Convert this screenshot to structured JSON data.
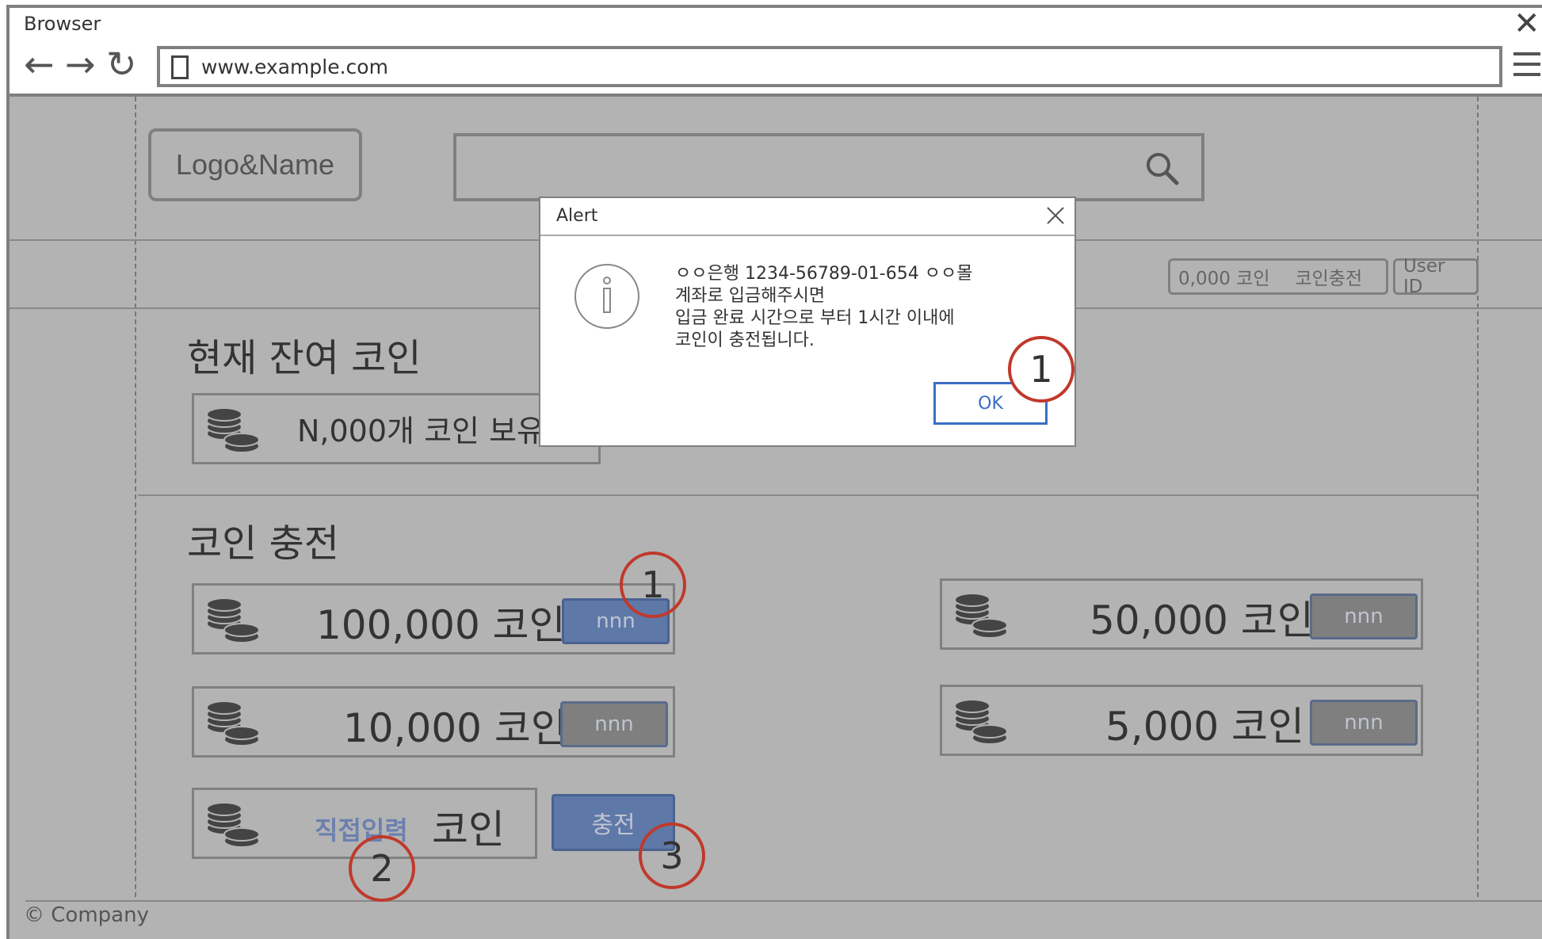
{
  "browser": {
    "title": "Browser",
    "url": "www.example.com",
    "close_glyph": "✕",
    "back_glyph": "←",
    "forward_glyph": "→",
    "reload_glyph": "↻"
  },
  "header": {
    "logo": "Logo&Name",
    "coin_balance": "0,000 코인",
    "charge_link": "코인충전",
    "user_id": "User ID"
  },
  "balance": {
    "title": "현재 잔여 코인",
    "text": "N,000개 코인 보유"
  },
  "charge": {
    "title": "코인 충전",
    "options": [
      {
        "amount": "100,000 코인",
        "price": "nnn"
      },
      {
        "amount": "50,000 코인",
        "price": "nnn"
      },
      {
        "amount": "10,000 코인",
        "price": "nnn"
      },
      {
        "amount": "5,000 코인",
        "price": "nnn"
      }
    ],
    "custom_input": "직접입력",
    "custom_unit": "코인",
    "submit": "충전"
  },
  "annotations": [
    "1",
    "1",
    "2",
    "3"
  ],
  "alert": {
    "title": "Alert",
    "lines": [
      "ㅇㅇ은행 1234-56789-01-654 ㅇㅇ몰",
      "계좌로 입금해주시면",
      "입금 완료 시간으로 부터 1시간 이내에",
      "코인이 충전됩니다."
    ],
    "ok": "OK"
  },
  "footer": "© Company",
  "colors": {
    "page_background": "#b3b3b3",
    "button_blue": "#5e78a8",
    "button_gray": "#7f7f7f",
    "annotation_red": "#c0392b",
    "ok_blue": "#3a6fc4"
  }
}
